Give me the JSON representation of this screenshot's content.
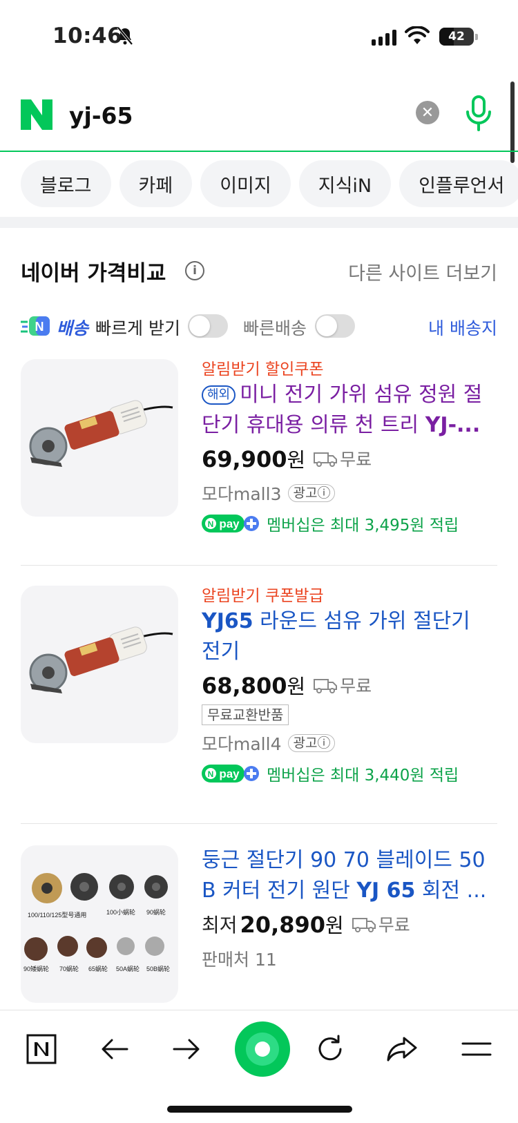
{
  "status_bar": {
    "time": "10:46",
    "battery": "42"
  },
  "search": {
    "brand": "N",
    "query": "yj-65"
  },
  "tabs": [
    "블로그",
    "카페",
    "이미지",
    "지식iN",
    "인플루언서"
  ],
  "section": {
    "title": "네이버 가격비교",
    "more": "다른 사이트 더보기",
    "delivery_badge": "N",
    "delivery_word": "배송",
    "filter1": "빠르게 받기",
    "filter2": "빠른배송",
    "my_address": "내 배송지"
  },
  "products": [
    {
      "promo": "알림받기 할인쿠폰",
      "badge": "해외",
      "title_line1": "미니 전기 가위 섬유 정원 절",
      "title_line2_pre": "단기 휴대용 의류 천 트리 ",
      "title_line2_bold": "YJ-...",
      "price": "69,900",
      "won": "원",
      "shipping": "무료",
      "seller": "모다mall3",
      "ad_label": "광고ⓘ",
      "pay_text": "멤버십은 최대 3,495원 적립"
    },
    {
      "promo": "알림받기 쿠폰발급",
      "title_bold": "YJ65",
      "title_line1_rest": " 라운드 섬유 가위 절단기",
      "title_line2": "전기",
      "price": "68,800",
      "won": "원",
      "shipping": "무료",
      "tag": "무료교환반품",
      "seller": "모다mall4",
      "ad_label": "광고ⓘ",
      "pay_text": "멤버십은 최대 3,440원 적립"
    },
    {
      "title_line1": "둥근 절단기 90 70 블레이드 50",
      "title_line2_pre": "B 커터 전기 원단 ",
      "title_line2_bold": "YJ 65",
      "title_line2_post": " 회전 ...",
      "price_prefix": "최저",
      "price": "20,890",
      "won": "원",
      "shipping": "무료",
      "seller": "판매처 11",
      "image_labels": [
        "100/110/125型号通用",
        "100小蜗轮",
        "90蜗轮",
        "90矮蜗轮",
        "70蜗轮",
        "65蜗轮",
        "50A蜗轮",
        "50B蜗轮"
      ]
    }
  ],
  "npay_label": "pay",
  "colors": {
    "naver_green": "#03c75a",
    "link_blue": "#1a56c4",
    "promo_red": "#eb4420",
    "visited_purple": "#7a1fa2",
    "pay_green": "#0da34a"
  }
}
